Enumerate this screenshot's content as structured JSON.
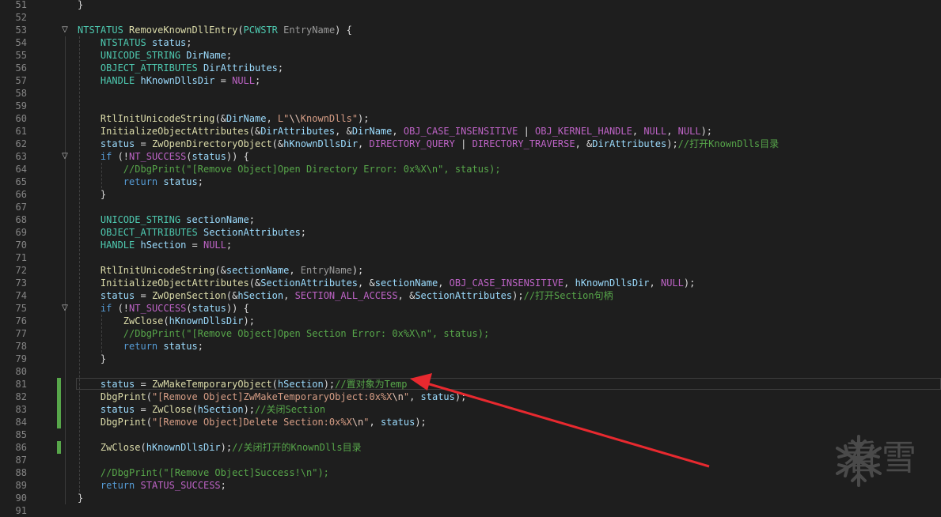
{
  "watermark": {
    "text": "看雪",
    "icon": "snowflake-icon"
  },
  "colors": {
    "background": "#1e1e1e",
    "line_number": "#858585",
    "change_bar": "#57a64a",
    "arrow": "#e8292f",
    "keyword": "#569cd6",
    "type": "#4ec9b0",
    "function": "#dcdcaa",
    "comment": "#57a64a",
    "string": "#d69d85",
    "macro": "#bd63c5"
  },
  "editor": {
    "current_line": 81,
    "change_marks": [
      81,
      82,
      83,
      84,
      86
    ],
    "lines": [
      {
        "n": "51",
        "fold": "",
        "tokens": [
          {
            "t": "pl",
            "v": "}"
          }
        ]
      },
      {
        "n": "52",
        "fold": "",
        "tokens": []
      },
      {
        "n": "53",
        "fold": "▽",
        "tokens": [
          {
            "t": "ty",
            "v": "NTSTATUS"
          },
          {
            "t": "pl",
            "v": " "
          },
          {
            "t": "fn",
            "v": "RemoveKnownDllEntry"
          },
          {
            "t": "pl",
            "v": "("
          },
          {
            "t": "ty",
            "v": "PCWSTR"
          },
          {
            "t": "pl",
            "v": " "
          },
          {
            "t": "par",
            "v": "EntryName"
          },
          {
            "t": "pl",
            "v": ") {"
          }
        ]
      },
      {
        "n": "54",
        "fold": "",
        "tokens": [
          {
            "t": "pl",
            "v": "    "
          },
          {
            "t": "ty",
            "v": "NTSTATUS"
          },
          {
            "t": "pl",
            "v": " "
          },
          {
            "t": "var",
            "v": "status"
          },
          {
            "t": "pl",
            "v": ";"
          }
        ]
      },
      {
        "n": "55",
        "fold": "",
        "tokens": [
          {
            "t": "pl",
            "v": "    "
          },
          {
            "t": "ty",
            "v": "UNICODE_STRING"
          },
          {
            "t": "pl",
            "v": " "
          },
          {
            "t": "var",
            "v": "DirName"
          },
          {
            "t": "pl",
            "v": ";"
          }
        ]
      },
      {
        "n": "56",
        "fold": "",
        "tokens": [
          {
            "t": "pl",
            "v": "    "
          },
          {
            "t": "ty",
            "v": "OBJECT_ATTRIBUTES"
          },
          {
            "t": "pl",
            "v": " "
          },
          {
            "t": "var",
            "v": "DirAttributes"
          },
          {
            "t": "pl",
            "v": ";"
          }
        ]
      },
      {
        "n": "57",
        "fold": "",
        "tokens": [
          {
            "t": "pl",
            "v": "    "
          },
          {
            "t": "ty",
            "v": "HANDLE"
          },
          {
            "t": "pl",
            "v": " "
          },
          {
            "t": "var",
            "v": "hKnownDllsDir"
          },
          {
            "t": "pl",
            "v": " = "
          },
          {
            "t": "mac",
            "v": "NULL"
          },
          {
            "t": "pl",
            "v": ";"
          }
        ]
      },
      {
        "n": "58",
        "fold": "",
        "tokens": []
      },
      {
        "n": "59",
        "fold": "",
        "tokens": []
      },
      {
        "n": "60",
        "fold": "",
        "tokens": [
          {
            "t": "pl",
            "v": "    "
          },
          {
            "t": "fn",
            "v": "RtlInitUnicodeString"
          },
          {
            "t": "pl",
            "v": "(&"
          },
          {
            "t": "var",
            "v": "DirName"
          },
          {
            "t": "pl",
            "v": ", "
          },
          {
            "t": "str",
            "v": "L\""
          },
          {
            "t": "esc",
            "v": "\\\\"
          },
          {
            "t": "str",
            "v": "KnownDlls\""
          },
          {
            "t": "pl",
            "v": ");"
          }
        ]
      },
      {
        "n": "61",
        "fold": "",
        "tokens": [
          {
            "t": "pl",
            "v": "    "
          },
          {
            "t": "fn",
            "v": "InitializeObjectAttributes"
          },
          {
            "t": "pl",
            "v": "(&"
          },
          {
            "t": "var",
            "v": "DirAttributes"
          },
          {
            "t": "pl",
            "v": ", &"
          },
          {
            "t": "var",
            "v": "DirName"
          },
          {
            "t": "pl",
            "v": ", "
          },
          {
            "t": "mac",
            "v": "OBJ_CASE_INSENSITIVE"
          },
          {
            "t": "pl",
            "v": " | "
          },
          {
            "t": "mac",
            "v": "OBJ_KERNEL_HANDLE"
          },
          {
            "t": "pl",
            "v": ", "
          },
          {
            "t": "mac",
            "v": "NULL"
          },
          {
            "t": "pl",
            "v": ", "
          },
          {
            "t": "mac",
            "v": "NULL"
          },
          {
            "t": "pl",
            "v": ");"
          }
        ]
      },
      {
        "n": "62",
        "fold": "",
        "tokens": [
          {
            "t": "pl",
            "v": "    "
          },
          {
            "t": "var",
            "v": "status"
          },
          {
            "t": "pl",
            "v": " = "
          },
          {
            "t": "fn",
            "v": "ZwOpenDirectoryObject"
          },
          {
            "t": "pl",
            "v": "(&"
          },
          {
            "t": "var",
            "v": "hKnownDllsDir"
          },
          {
            "t": "pl",
            "v": ", "
          },
          {
            "t": "mac",
            "v": "DIRECTORY_QUERY"
          },
          {
            "t": "pl",
            "v": " | "
          },
          {
            "t": "mac",
            "v": "DIRECTORY_TRAVERSE"
          },
          {
            "t": "pl",
            "v": ", &"
          },
          {
            "t": "var",
            "v": "DirAttributes"
          },
          {
            "t": "pl",
            "v": ");"
          },
          {
            "t": "cm",
            "v": "//打开KnownDlls目录"
          }
        ]
      },
      {
        "n": "63",
        "fold": "▽",
        "tokens": [
          {
            "t": "pl",
            "v": "    "
          },
          {
            "t": "kw",
            "v": "if"
          },
          {
            "t": "pl",
            "v": " (!"
          },
          {
            "t": "mac",
            "v": "NT_SUCCESS"
          },
          {
            "t": "pl",
            "v": "("
          },
          {
            "t": "var",
            "v": "status"
          },
          {
            "t": "pl",
            "v": ")) {"
          }
        ]
      },
      {
        "n": "64",
        "fold": "",
        "tokens": [
          {
            "t": "pl",
            "v": "        "
          },
          {
            "t": "cm",
            "v": "//DbgPrint(\"[Remove Object]Open Directory Error: 0x%X\\n\", status);"
          }
        ]
      },
      {
        "n": "65",
        "fold": "",
        "tokens": [
          {
            "t": "pl",
            "v": "        "
          },
          {
            "t": "kw",
            "v": "return"
          },
          {
            "t": "pl",
            "v": " "
          },
          {
            "t": "var",
            "v": "status"
          },
          {
            "t": "pl",
            "v": ";"
          }
        ]
      },
      {
        "n": "66",
        "fold": "",
        "tokens": [
          {
            "t": "pl",
            "v": "    }"
          }
        ]
      },
      {
        "n": "67",
        "fold": "",
        "tokens": []
      },
      {
        "n": "68",
        "fold": "",
        "tokens": [
          {
            "t": "pl",
            "v": "    "
          },
          {
            "t": "ty",
            "v": "UNICODE_STRING"
          },
          {
            "t": "pl",
            "v": " "
          },
          {
            "t": "var",
            "v": "sectionName"
          },
          {
            "t": "pl",
            "v": ";"
          }
        ]
      },
      {
        "n": "69",
        "fold": "",
        "tokens": [
          {
            "t": "pl",
            "v": "    "
          },
          {
            "t": "ty",
            "v": "OBJECT_ATTRIBUTES"
          },
          {
            "t": "pl",
            "v": " "
          },
          {
            "t": "var",
            "v": "SectionAttributes"
          },
          {
            "t": "pl",
            "v": ";"
          }
        ]
      },
      {
        "n": "70",
        "fold": "",
        "tokens": [
          {
            "t": "pl",
            "v": "    "
          },
          {
            "t": "ty",
            "v": "HANDLE"
          },
          {
            "t": "pl",
            "v": " "
          },
          {
            "t": "var",
            "v": "hSection"
          },
          {
            "t": "pl",
            "v": " = "
          },
          {
            "t": "mac",
            "v": "NULL"
          },
          {
            "t": "pl",
            "v": ";"
          }
        ]
      },
      {
        "n": "71",
        "fold": "",
        "tokens": []
      },
      {
        "n": "72",
        "fold": "",
        "tokens": [
          {
            "t": "pl",
            "v": "    "
          },
          {
            "t": "fn",
            "v": "RtlInitUnicodeString"
          },
          {
            "t": "pl",
            "v": "(&"
          },
          {
            "t": "var",
            "v": "sectionName"
          },
          {
            "t": "pl",
            "v": ", "
          },
          {
            "t": "par",
            "v": "EntryName"
          },
          {
            "t": "pl",
            "v": ");"
          }
        ]
      },
      {
        "n": "73",
        "fold": "",
        "tokens": [
          {
            "t": "pl",
            "v": "    "
          },
          {
            "t": "fn",
            "v": "InitializeObjectAttributes"
          },
          {
            "t": "pl",
            "v": "(&"
          },
          {
            "t": "var",
            "v": "SectionAttributes"
          },
          {
            "t": "pl",
            "v": ", &"
          },
          {
            "t": "var",
            "v": "sectionName"
          },
          {
            "t": "pl",
            "v": ", "
          },
          {
            "t": "mac",
            "v": "OBJ_CASE_INSENSITIVE"
          },
          {
            "t": "pl",
            "v": ", "
          },
          {
            "t": "var",
            "v": "hKnownDllsDir"
          },
          {
            "t": "pl",
            "v": ", "
          },
          {
            "t": "mac",
            "v": "NULL"
          },
          {
            "t": "pl",
            "v": ");"
          }
        ]
      },
      {
        "n": "74",
        "fold": "",
        "tokens": [
          {
            "t": "pl",
            "v": "    "
          },
          {
            "t": "var",
            "v": "status"
          },
          {
            "t": "pl",
            "v": " = "
          },
          {
            "t": "fn",
            "v": "ZwOpenSection"
          },
          {
            "t": "pl",
            "v": "(&"
          },
          {
            "t": "var",
            "v": "hSection"
          },
          {
            "t": "pl",
            "v": ", "
          },
          {
            "t": "mac",
            "v": "SECTION_ALL_ACCESS"
          },
          {
            "t": "pl",
            "v": ", &"
          },
          {
            "t": "var",
            "v": "SectionAttributes"
          },
          {
            "t": "pl",
            "v": ");"
          },
          {
            "t": "cm",
            "v": "//打开Section句柄"
          }
        ]
      },
      {
        "n": "75",
        "fold": "▽",
        "tokens": [
          {
            "t": "pl",
            "v": "    "
          },
          {
            "t": "kw",
            "v": "if"
          },
          {
            "t": "pl",
            "v": " (!"
          },
          {
            "t": "mac",
            "v": "NT_SUCCESS"
          },
          {
            "t": "pl",
            "v": "("
          },
          {
            "t": "var",
            "v": "status"
          },
          {
            "t": "pl",
            "v": ")) {"
          }
        ]
      },
      {
        "n": "76",
        "fold": "",
        "tokens": [
          {
            "t": "pl",
            "v": "        "
          },
          {
            "t": "fn",
            "v": "ZwClose"
          },
          {
            "t": "pl",
            "v": "("
          },
          {
            "t": "var",
            "v": "hKnownDllsDir"
          },
          {
            "t": "pl",
            "v": ");"
          }
        ]
      },
      {
        "n": "77",
        "fold": "",
        "tokens": [
          {
            "t": "pl",
            "v": "        "
          },
          {
            "t": "cm",
            "v": "//DbgPrint(\"[Remove Object]Open Section Error: 0x%X\\n\", status);"
          }
        ]
      },
      {
        "n": "78",
        "fold": "",
        "tokens": [
          {
            "t": "pl",
            "v": "        "
          },
          {
            "t": "kw",
            "v": "return"
          },
          {
            "t": "pl",
            "v": " "
          },
          {
            "t": "var",
            "v": "status"
          },
          {
            "t": "pl",
            "v": ";"
          }
        ]
      },
      {
        "n": "79",
        "fold": "",
        "tokens": [
          {
            "t": "pl",
            "v": "    }"
          }
        ]
      },
      {
        "n": "80",
        "fold": "",
        "tokens": []
      },
      {
        "n": "81",
        "fold": "",
        "tokens": [
          {
            "t": "pl",
            "v": "    "
          },
          {
            "t": "var",
            "v": "status"
          },
          {
            "t": "pl",
            "v": " = "
          },
          {
            "t": "fn",
            "v": "ZwMakeTemporaryObject"
          },
          {
            "t": "pl",
            "v": "("
          },
          {
            "t": "var",
            "v": "hSection"
          },
          {
            "t": "pl",
            "v": ");"
          },
          {
            "t": "cm",
            "v": "//置对象为Temp"
          }
        ]
      },
      {
        "n": "82",
        "fold": "",
        "tokens": [
          {
            "t": "pl",
            "v": "    "
          },
          {
            "t": "fn",
            "v": "DbgPrint"
          },
          {
            "t": "pl",
            "v": "("
          },
          {
            "t": "str",
            "v": "\"[Remove Object]ZwMakeTemporaryObject:0x%X"
          },
          {
            "t": "esc",
            "v": "\\n"
          },
          {
            "t": "str",
            "v": "\""
          },
          {
            "t": "pl",
            "v": ", "
          },
          {
            "t": "var",
            "v": "status"
          },
          {
            "t": "pl",
            "v": ");"
          }
        ]
      },
      {
        "n": "83",
        "fold": "",
        "tokens": [
          {
            "t": "pl",
            "v": "    "
          },
          {
            "t": "var",
            "v": "status"
          },
          {
            "t": "pl",
            "v": " = "
          },
          {
            "t": "fn",
            "v": "ZwClose"
          },
          {
            "t": "pl",
            "v": "("
          },
          {
            "t": "var",
            "v": "hSection"
          },
          {
            "t": "pl",
            "v": ");"
          },
          {
            "t": "cm",
            "v": "//关闭Section"
          }
        ]
      },
      {
        "n": "84",
        "fold": "",
        "tokens": [
          {
            "t": "pl",
            "v": "    "
          },
          {
            "t": "fn",
            "v": "DbgPrint"
          },
          {
            "t": "pl",
            "v": "("
          },
          {
            "t": "str",
            "v": "\"[Remove Object]Delete Section:0x%X"
          },
          {
            "t": "esc",
            "v": "\\n"
          },
          {
            "t": "str",
            "v": "\""
          },
          {
            "t": "pl",
            "v": ", "
          },
          {
            "t": "var",
            "v": "status"
          },
          {
            "t": "pl",
            "v": ");"
          }
        ]
      },
      {
        "n": "85",
        "fold": "",
        "tokens": []
      },
      {
        "n": "86",
        "fold": "",
        "tokens": [
          {
            "t": "pl",
            "v": "    "
          },
          {
            "t": "fn",
            "v": "ZwClose"
          },
          {
            "t": "pl",
            "v": "("
          },
          {
            "t": "var",
            "v": "hKnownDllsDir"
          },
          {
            "t": "pl",
            "v": ");"
          },
          {
            "t": "cm",
            "v": "//关闭打开的KnownDlls目录"
          }
        ]
      },
      {
        "n": "87",
        "fold": "",
        "tokens": []
      },
      {
        "n": "88",
        "fold": "",
        "tokens": [
          {
            "t": "pl",
            "v": "    "
          },
          {
            "t": "cm",
            "v": "//DbgPrint(\"[Remove Object]Success!\\n\");"
          }
        ]
      },
      {
        "n": "89",
        "fold": "",
        "tokens": [
          {
            "t": "pl",
            "v": "    "
          },
          {
            "t": "kw",
            "v": "return"
          },
          {
            "t": "pl",
            "v": " "
          },
          {
            "t": "mac",
            "v": "STATUS_SUCCESS"
          },
          {
            "t": "pl",
            "v": ";"
          }
        ]
      },
      {
        "n": "90",
        "fold": "",
        "tokens": [
          {
            "t": "pl",
            "v": "}"
          }
        ]
      },
      {
        "n": "91",
        "fold": "",
        "tokens": []
      }
    ]
  }
}
